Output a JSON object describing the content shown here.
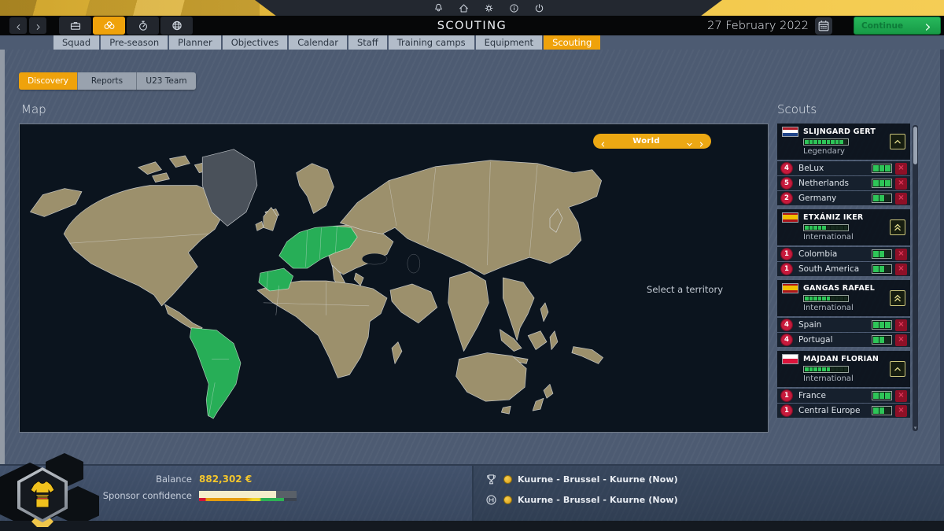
{
  "system_icons": [
    {
      "name": "bell"
    },
    {
      "name": "home"
    },
    {
      "name": "settings"
    },
    {
      "name": "info"
    },
    {
      "name": "power"
    }
  ],
  "header": {
    "title": "SCOUTING",
    "date": "27 February 2022",
    "continue_label": "Continue"
  },
  "nav_icons": [
    {
      "name": "briefcase",
      "active": false
    },
    {
      "name": "scouting",
      "active": true
    },
    {
      "name": "stopwatch",
      "active": false
    },
    {
      "name": "globe",
      "active": false
    }
  ],
  "nav_tabs": {
    "items": [
      {
        "label": "Squad",
        "active": false
      },
      {
        "label": "Pre-season",
        "active": false
      },
      {
        "label": "Planner",
        "active": false
      },
      {
        "label": "Objectives",
        "active": false
      },
      {
        "label": "Calendar",
        "active": false
      },
      {
        "label": "Staff",
        "active": false
      },
      {
        "label": "Training camps",
        "active": false
      },
      {
        "label": "Equipment",
        "active": false
      },
      {
        "label": "Scouting",
        "active": true
      }
    ]
  },
  "subtabs": {
    "items": [
      {
        "label": "Discovery",
        "active": true
      },
      {
        "label": "Reports",
        "active": false
      },
      {
        "label": "U23 Team",
        "active": false
      }
    ]
  },
  "map": {
    "section_title": "Map",
    "selector_label": "World",
    "hint": "Select a territory",
    "colors": {
      "land": "#9c906c",
      "highlight": "#27ae57",
      "muted_land": "#4a515a",
      "ocean": "#0b141e"
    }
  },
  "scouts_panel": {
    "title": "Scouts",
    "scouts": [
      {
        "name": "SLIJNGARD GERT",
        "country_flag": "netherlands",
        "tier": "Legendary",
        "skill": 9,
        "skill_max": 10,
        "promote_arrows": 1,
        "regions": [
          {
            "count": 4,
            "name": "BeLux",
            "progress": 3
          },
          {
            "count": 5,
            "name": "Netherlands",
            "progress": 3
          },
          {
            "count": 2,
            "name": "Germany",
            "progress": 2
          }
        ]
      },
      {
        "name": "ETXÁNIZ IKER",
        "country_flag": "spain",
        "tier": "International",
        "skill": 5,
        "skill_max": 10,
        "promote_arrows": 2,
        "regions": [
          {
            "count": 1,
            "name": "Colombia",
            "progress": 2
          },
          {
            "count": 1,
            "name": "South America",
            "progress": 2
          }
        ]
      },
      {
        "name": "GANGAS RAFAEL",
        "country_flag": "spain",
        "tier": "International",
        "skill": 6,
        "skill_max": 10,
        "promote_arrows": 2,
        "regions": [
          {
            "count": 4,
            "name": "Spain",
            "progress": 3
          },
          {
            "count": 4,
            "name": "Portugal",
            "progress": 2
          }
        ]
      },
      {
        "name": "MAJDAN FLORIAN",
        "country_flag": "poland",
        "tier": "International",
        "skill": 6,
        "skill_max": 10,
        "promote_arrows": 1,
        "regions": [
          {
            "count": 1,
            "name": "France",
            "progress": 3
          },
          {
            "count": 1,
            "name": "Central Europe",
            "progress": 2
          }
        ]
      }
    ]
  },
  "flags": {
    "netherlands": [
      "#AE1C28",
      "#FFFFFF",
      "#21468B"
    ],
    "spain": [
      "#AA151B",
      "#F1BF00",
      "#F1BF00",
      "#AA151B"
    ],
    "poland": [
      "#FFFFFF",
      "#DC143C"
    ]
  },
  "footer": {
    "balance_label": "Balance",
    "balance_value": "882,302 €",
    "sponsor_label": "Sponsor confidence",
    "sponsor_fill_pct": 79,
    "races": [
      {
        "icon": "trophy",
        "label": "Kuurne - Brussel - Kuurne (Now)"
      },
      {
        "icon": "finish-gate",
        "label": "Kuurne - Brussel - Kuurne (Now)"
      }
    ]
  },
  "colors": {
    "accent": "#efa20b",
    "positive": "#2ec558",
    "balance_value": "#f4c62c",
    "danger": "#b51535"
  }
}
